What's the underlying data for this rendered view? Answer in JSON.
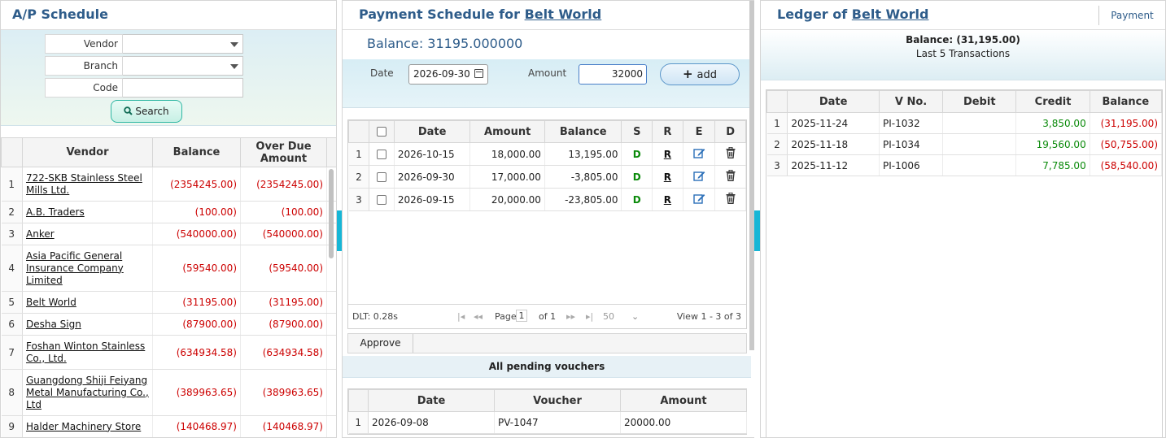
{
  "left": {
    "title": "A/P Schedule",
    "filters": [
      {
        "label": "Vendor",
        "value": "",
        "type": "select"
      },
      {
        "label": "Branch",
        "value": "",
        "type": "select"
      },
      {
        "label": "Code",
        "value": "",
        "type": "text"
      }
    ],
    "search_label": "Search",
    "columns": [
      "Vendor",
      "Balance",
      "Over Due Amount"
    ],
    "rows": [
      {
        "n": "1",
        "vendor": [
          "722-SKB Stainless Steel",
          "Mills Ltd."
        ],
        "balance": "(2354245.00)",
        "overdue": "(2354245.00)"
      },
      {
        "n": "2",
        "vendor": [
          "A.B. Traders"
        ],
        "balance": "(100.00)",
        "overdue": "(100.00)"
      },
      {
        "n": "3",
        "vendor": [
          "Anker"
        ],
        "balance": "(540000.00)",
        "overdue": "(540000.00)"
      },
      {
        "n": "4",
        "vendor": [
          "Asia Pacific General",
          "Insurance Company",
          "Limited"
        ],
        "balance": "(59540.00)",
        "overdue": "(59540.00)"
      },
      {
        "n": "5",
        "vendor": [
          "Belt World"
        ],
        "balance": "(31195.00)",
        "overdue": "(31195.00)"
      },
      {
        "n": "6",
        "vendor": [
          "Desha Sign"
        ],
        "balance": "(87900.00)",
        "overdue": "(87900.00)"
      },
      {
        "n": "7",
        "vendor": [
          "Foshan Winton Stainless",
          "Co., Ltd."
        ],
        "balance": "(634934.58)",
        "overdue": "(634934.58)"
      },
      {
        "n": "8",
        "vendor": [
          "Guangdong Shiji Feiyang",
          "Metal Manufacturing Co.,",
          "Ltd"
        ],
        "balance": "(389963.65)",
        "overdue": "(389963.65)"
      },
      {
        "n": "9",
        "vendor": [
          "Halder Machinery Store"
        ],
        "balance": "(140468.97)",
        "overdue": "(140468.97)"
      }
    ]
  },
  "middle": {
    "title_prefix": "Payment Schedule for",
    "title_vendor": "Belt World",
    "balance_text": "Balance: 31195.000000",
    "date_label": "Date",
    "date_value": "2026-09-30",
    "amount_label": "Amount",
    "amount_value": "32000",
    "add_label": "add",
    "columns": [
      "",
      "Date",
      "Amount",
      "Balance",
      "S",
      "R",
      "E",
      "D"
    ],
    "rows": [
      {
        "n": "1",
        "date": "2026-10-15",
        "amount": "18,000.00",
        "balance": "13,195.00",
        "s": "D",
        "r": "R"
      },
      {
        "n": "2",
        "date": "2026-09-30",
        "amount": "17,000.00",
        "balance": "-3,805.00",
        "s": "D",
        "r": "R"
      },
      {
        "n": "3",
        "date": "2026-09-15",
        "amount": "20,000.00",
        "balance": "-23,805.00",
        "s": "D",
        "r": "R"
      }
    ],
    "pager": {
      "dlt": "DLT: 0.28s",
      "page_label": "Page",
      "page_value": "1",
      "of_label": "of 1",
      "rows_per_page": "50",
      "view_text": "View 1 - 3 of 3"
    },
    "approve_label": "Approve",
    "pending_title": "All pending vouchers",
    "pending_columns": [
      "Date",
      "Voucher",
      "Amount"
    ],
    "pending_rows": [
      {
        "n": "1",
        "date": "2026-09-08",
        "voucher": "PV-1047",
        "amount": "20000.00"
      }
    ]
  },
  "right": {
    "title_prefix": "Ledger of",
    "title_vendor": "Belt World",
    "tab_label": "Payment",
    "balance_text": "Balance: (31,195.00)",
    "subtitle": "Last 5 Transactions",
    "columns": [
      "Date",
      "V No.",
      "Debit",
      "Credit",
      "Balance"
    ],
    "rows": [
      {
        "n": "1",
        "date": "2025-11-24",
        "vno": "PI-1032",
        "debit": "",
        "credit": "3,850.00",
        "balance": "(31,195.00)"
      },
      {
        "n": "2",
        "date": "2025-11-18",
        "vno": "PI-1034",
        "debit": "",
        "credit": "19,560.00",
        "balance": "(50,755.00)"
      },
      {
        "n": "3",
        "date": "2025-11-12",
        "vno": "PI-1006",
        "debit": "",
        "credit": "7,785.00",
        "balance": "(58,540.00)"
      }
    ]
  },
  "colors": {
    "title": "#2e5c8a",
    "negative": "#cc0000",
    "positive": "#0a8a0a",
    "splitter": "#16b6d6"
  },
  "icons": {
    "edit": "edit-icon",
    "delete": "trash-icon",
    "search": "search-icon",
    "calendar": "calendar-icon",
    "add": "plus-icon"
  }
}
